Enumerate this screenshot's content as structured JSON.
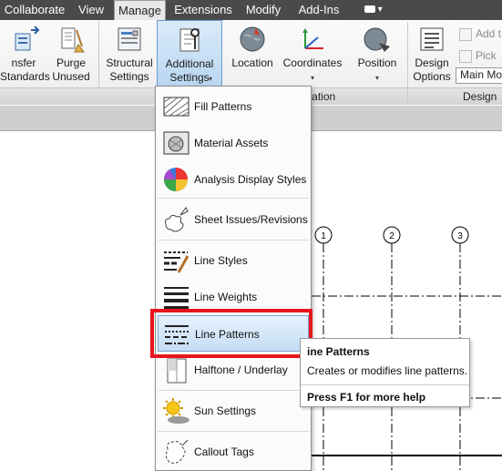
{
  "tabs": [
    "Collaborate",
    "View",
    "Manage",
    "Extensions",
    "Modify",
    "Add-Ins"
  ],
  "active_tab": "Manage",
  "ribbon": {
    "transfer": {
      "l1": "nsfer",
      "l2": "Standards"
    },
    "purge": {
      "l1": "Purge",
      "l2": "Unused"
    },
    "structural": {
      "l1": "Structural",
      "l2": "Settings"
    },
    "additional": {
      "l1": "Additional",
      "l2": "Settings"
    },
    "location": {
      "l1": "Location"
    },
    "coordinates": {
      "l1": "Coordinates"
    },
    "position": {
      "l1": "Position"
    },
    "design_options": {
      "l1": "Design",
      "l2": "Options"
    },
    "add_to": "Add t",
    "pick_to": "Pick t",
    "main_model": "Main Mo",
    "panel_location": "Location",
    "panel_design": "Design O"
  },
  "menu": {
    "items": [
      {
        "label": "Fill Patterns",
        "icon": "fill-patterns-icon"
      },
      {
        "label": "Material Assets",
        "icon": "material-assets-icon"
      },
      {
        "label": "Analysis Display Styles",
        "icon": "analysis-display-styles-icon"
      },
      {
        "label": "Sheet Issues/Revisions",
        "icon": "sheet-issues-icon"
      },
      {
        "label": "Line Styles",
        "icon": "line-styles-icon"
      },
      {
        "label": "Line Weights",
        "icon": "line-weights-icon"
      },
      {
        "label": "Line Patterns",
        "icon": "line-patterns-icon"
      },
      {
        "label": "Halftone / Underlay",
        "icon": "halftone-icon"
      },
      {
        "label": "Sun Settings",
        "icon": "sun-settings-icon"
      },
      {
        "label": "Callout Tags",
        "icon": "callout-tags-icon"
      }
    ],
    "highlighted": "Line Patterns"
  },
  "tooltip": {
    "title": "ine Patterns",
    "description": "Creates or modifies line patterns.",
    "help": "Press F1 for more help"
  },
  "grid": {
    "labels": [
      "1",
      "2",
      "3"
    ]
  },
  "colors": {
    "highlight_border": "#e8141c",
    "tab_bar": "#4a4a4a",
    "menu_hover": "#c4ddf5"
  }
}
